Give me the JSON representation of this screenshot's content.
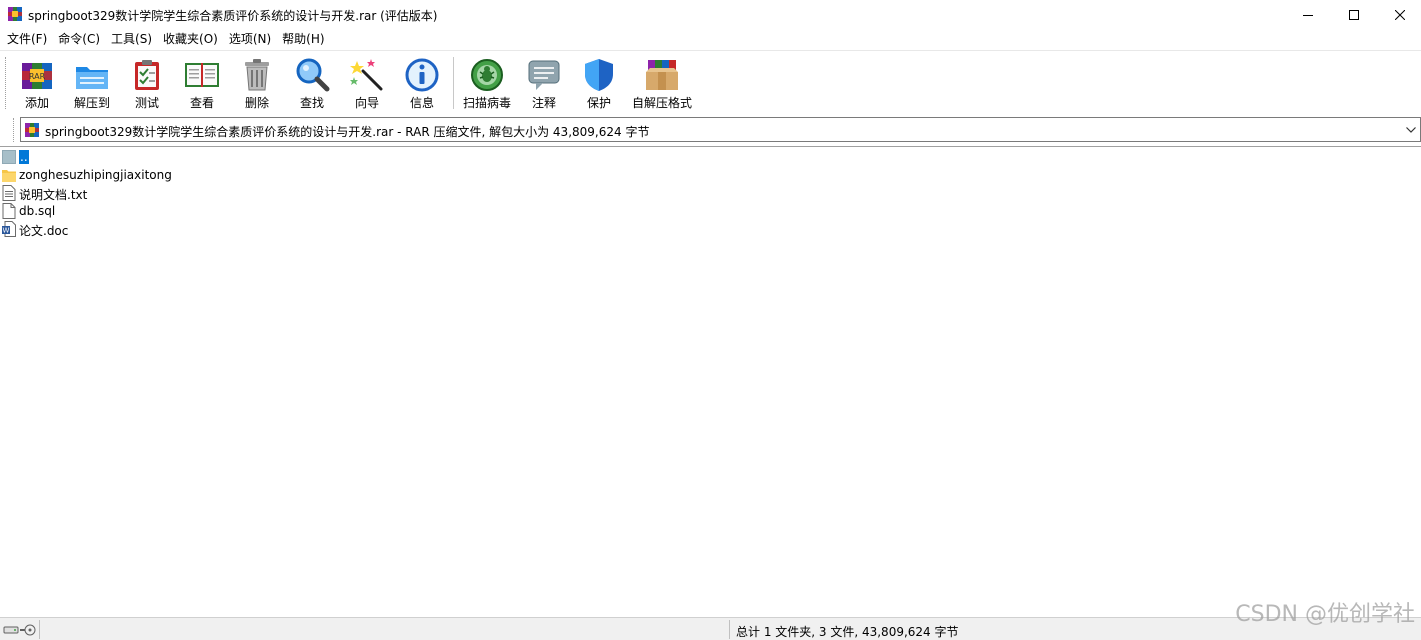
{
  "window": {
    "title": "springboot329数计学院学生综合素质评价系统的设计与开发.rar (评估版本)"
  },
  "menu": [
    {
      "label": "文件(F)"
    },
    {
      "label": "命令(C)"
    },
    {
      "label": "工具(S)"
    },
    {
      "label": "收藏夹(O)"
    },
    {
      "label": "选项(N)"
    },
    {
      "label": "帮助(H)"
    }
  ],
  "toolbar": {
    "buttons": [
      {
        "label": "添加",
        "icon": "add-archive-icon"
      },
      {
        "label": "解压到",
        "icon": "extract-folder-icon"
      },
      {
        "label": "测试",
        "icon": "test-clipboard-icon"
      },
      {
        "label": "查看",
        "icon": "view-book-icon"
      },
      {
        "label": "删除",
        "icon": "trash-icon"
      },
      {
        "label": "查找",
        "icon": "magnifier-icon"
      },
      {
        "label": "向导",
        "icon": "wizard-wand-icon"
      },
      {
        "label": "信息",
        "icon": "info-icon"
      },
      {
        "label": "扫描病毒",
        "icon": "virus-scan-icon"
      },
      {
        "label": "注释",
        "icon": "comment-icon"
      },
      {
        "label": "保护",
        "icon": "shield-icon"
      },
      {
        "label": "自解压格式",
        "icon": "sfx-box-icon"
      }
    ]
  },
  "address": {
    "text": "springboot329数计学院学生综合素质评价系统的设计与开发.rar - RAR 压缩文件, 解包大小为 43,809,624 字节"
  },
  "files": [
    {
      "name": "..",
      "icon": "parent-folder-icon",
      "selected": true
    },
    {
      "name": "zonghesuzhipingjiaxitong",
      "icon": "folder-icon"
    },
    {
      "name": "说明文档.txt",
      "icon": "text-file-icon"
    },
    {
      "name": "db.sql",
      "icon": "blank-file-icon"
    },
    {
      "name": "论文.doc",
      "icon": "word-doc-icon"
    }
  ],
  "status": {
    "summary": "总计 1 文件夹, 3 文件, 43,809,624 字节"
  },
  "watermark": "CSDN @优创学社"
}
